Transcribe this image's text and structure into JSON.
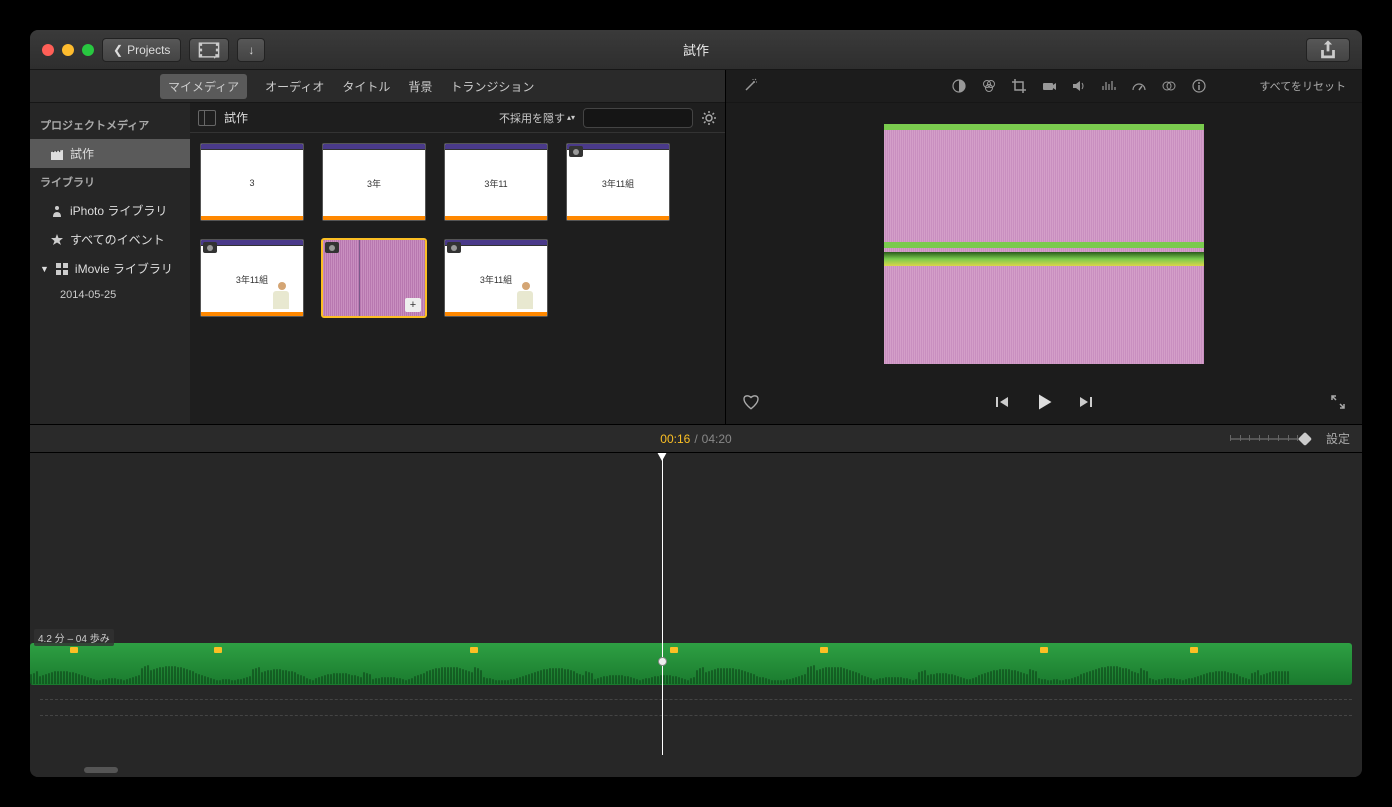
{
  "window": {
    "title": "試作",
    "back_label": "Projects"
  },
  "tabs": [
    "マイメディア",
    "オーディオ",
    "タイトル",
    "背景",
    "トランジション"
  ],
  "active_tab": 0,
  "sidebar": {
    "sections": [
      {
        "header": "プロジェクトメディア",
        "items": [
          {
            "icon": "clapper",
            "label": "試作",
            "active": true
          }
        ]
      },
      {
        "header": "ライブラリ",
        "items": [
          {
            "icon": "person",
            "label": "iPhoto ライブラリ"
          },
          {
            "icon": "star",
            "label": "すべてのイベント"
          },
          {
            "icon": "grid",
            "label": "iMovie ライブラリ",
            "expanded": true,
            "children": [
              "2014-05-25"
            ]
          }
        ]
      }
    ]
  },
  "content": {
    "title": "試作",
    "filter_label": "不採用を隠す",
    "search_placeholder": "",
    "clips": [
      {
        "text": "3",
        "badge": false
      },
      {
        "text": "3年",
        "badge": false
      },
      {
        "text": "3年11",
        "badge": false
      },
      {
        "text": "3年11組",
        "badge": true
      },
      {
        "text": "3年11組",
        "badge": true,
        "person": true
      },
      {
        "special": true,
        "selected": true,
        "badge": true,
        "plus": true
      },
      {
        "text": "3年11組",
        "badge": true,
        "person": true
      }
    ]
  },
  "viewer": {
    "reset_label": "すべてをリセット"
  },
  "timeline": {
    "current_time": "00:16",
    "total_time": "04:20",
    "settings_label": "設定",
    "audio_label": "4.2 分 – 04 歩み"
  }
}
